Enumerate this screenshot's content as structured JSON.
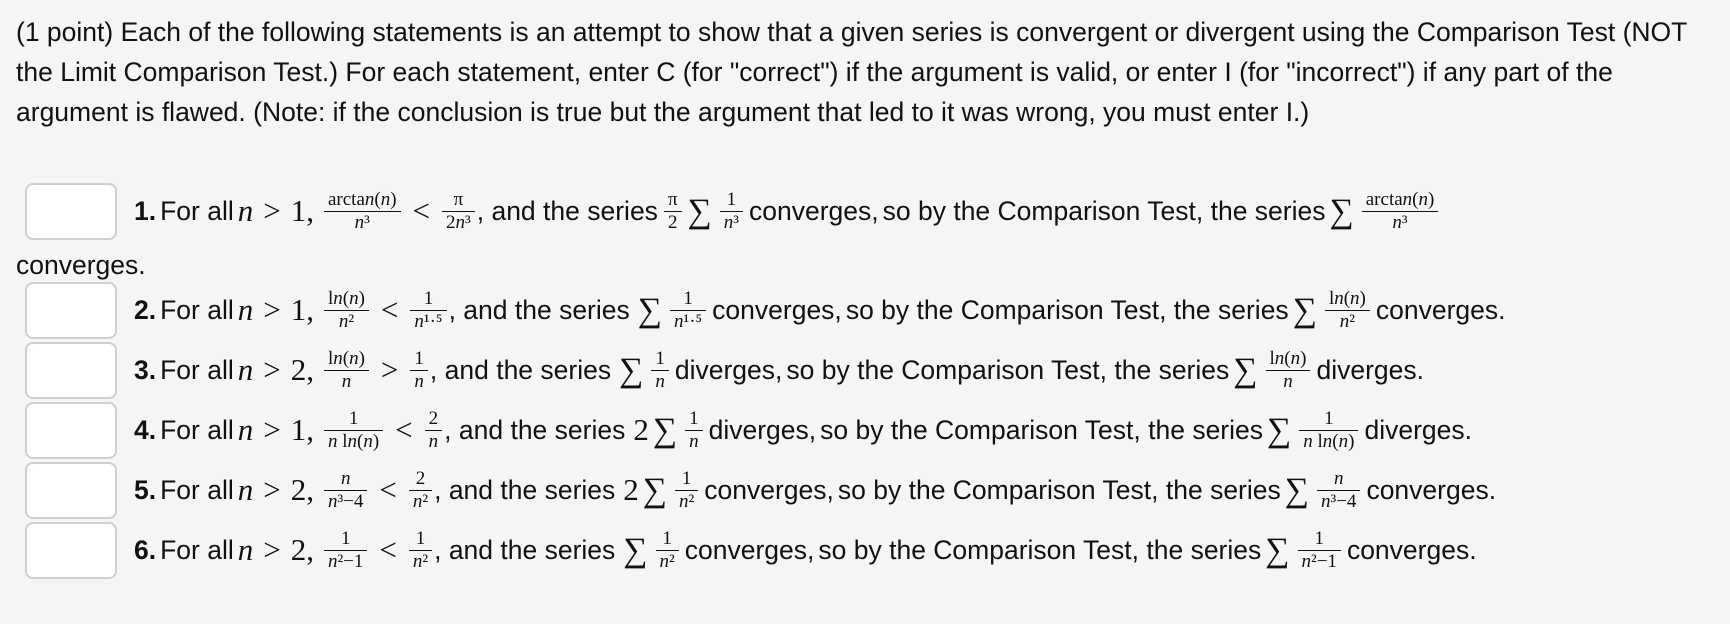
{
  "intro": "(1 point) Each of the following statements is an attempt to show that a given series is convergent or divergent using the Comparison Test (NOT the Limit Comparison Test.) For each statement, enter C (for \"correct\") if the argument is valid, or enter I (for \"incorrect\") if any part of the argument is flawed. (Note: if the conclusion is true but the argument that led to it was wrong, you must enter I.)",
  "common": {
    "for_all": "For all",
    "and_series": ", and the series",
    "so_by": "so by the Comparison Test, the series",
    "sigma": "∑",
    "n": "n",
    "comma": ","
  },
  "statements": [
    {
      "number": "1.",
      "answer": "",
      "bound": "1",
      "relation": "<",
      "lhs": {
        "num": "arctan(n)",
        "den": "n³"
      },
      "rhs": {
        "num": "π",
        "den": "2n³"
      },
      "comparison_prefix": {
        "num": "π",
        "den": "2"
      },
      "comparison": {
        "num": "1",
        "den": "n³"
      },
      "comparison_result": "converges,",
      "target": {
        "num": "arctan(n)",
        "den": "n³"
      },
      "conclusion": "converges."
    },
    {
      "number": "2.",
      "answer": "",
      "bound": "1",
      "relation": "<",
      "lhs": {
        "num": "ln(n)",
        "den": "n²"
      },
      "rhs": {
        "num": "1",
        "den": "n¹·⁵"
      },
      "comparison_prefix": "",
      "comparison": {
        "num": "1",
        "den": "n¹·⁵"
      },
      "comparison_result": "converges,",
      "target": {
        "num": "ln(n)",
        "den": "n²"
      },
      "conclusion": "converges."
    },
    {
      "number": "3.",
      "answer": "",
      "bound": "2",
      "relation": ">",
      "lhs": {
        "num": "ln(n)",
        "den": "n"
      },
      "rhs": {
        "num": "1",
        "den": "n"
      },
      "comparison_prefix": "",
      "comparison": {
        "num": "1",
        "den": "n"
      },
      "comparison_result": "diverges,",
      "target": {
        "num": "ln(n)",
        "den": "n"
      },
      "conclusion": "diverges."
    },
    {
      "number": "4.",
      "answer": "",
      "bound": "1",
      "relation": "<",
      "lhs": {
        "num": "1",
        "den": "n ln(n)"
      },
      "rhs": {
        "num": "2",
        "den": "n"
      },
      "comparison_prefix": "2",
      "comparison": {
        "num": "1",
        "den": "n"
      },
      "comparison_result": "diverges,",
      "target": {
        "num": "1",
        "den": "n ln(n)"
      },
      "conclusion": "diverges."
    },
    {
      "number": "5.",
      "answer": "",
      "bound": "2",
      "relation": "<",
      "lhs": {
        "num": "n",
        "den": "n³−4"
      },
      "rhs": {
        "num": "2",
        "den": "n²"
      },
      "comparison_prefix": "2",
      "comparison": {
        "num": "1",
        "den": "n²"
      },
      "comparison_result": "converges,",
      "target": {
        "num": "n",
        "den": "n³−4"
      },
      "conclusion": "converges."
    },
    {
      "number": "6.",
      "answer": "",
      "bound": "2",
      "relation": "<",
      "lhs": {
        "num": "1",
        "den": "n²−1"
      },
      "rhs": {
        "num": "1",
        "den": "n²"
      },
      "comparison_prefix": "",
      "comparison": {
        "num": "1",
        "den": "n²"
      },
      "comparison_result": "converges,",
      "target": {
        "num": "1",
        "den": "n²−1"
      },
      "conclusion": "converges."
    }
  ]
}
